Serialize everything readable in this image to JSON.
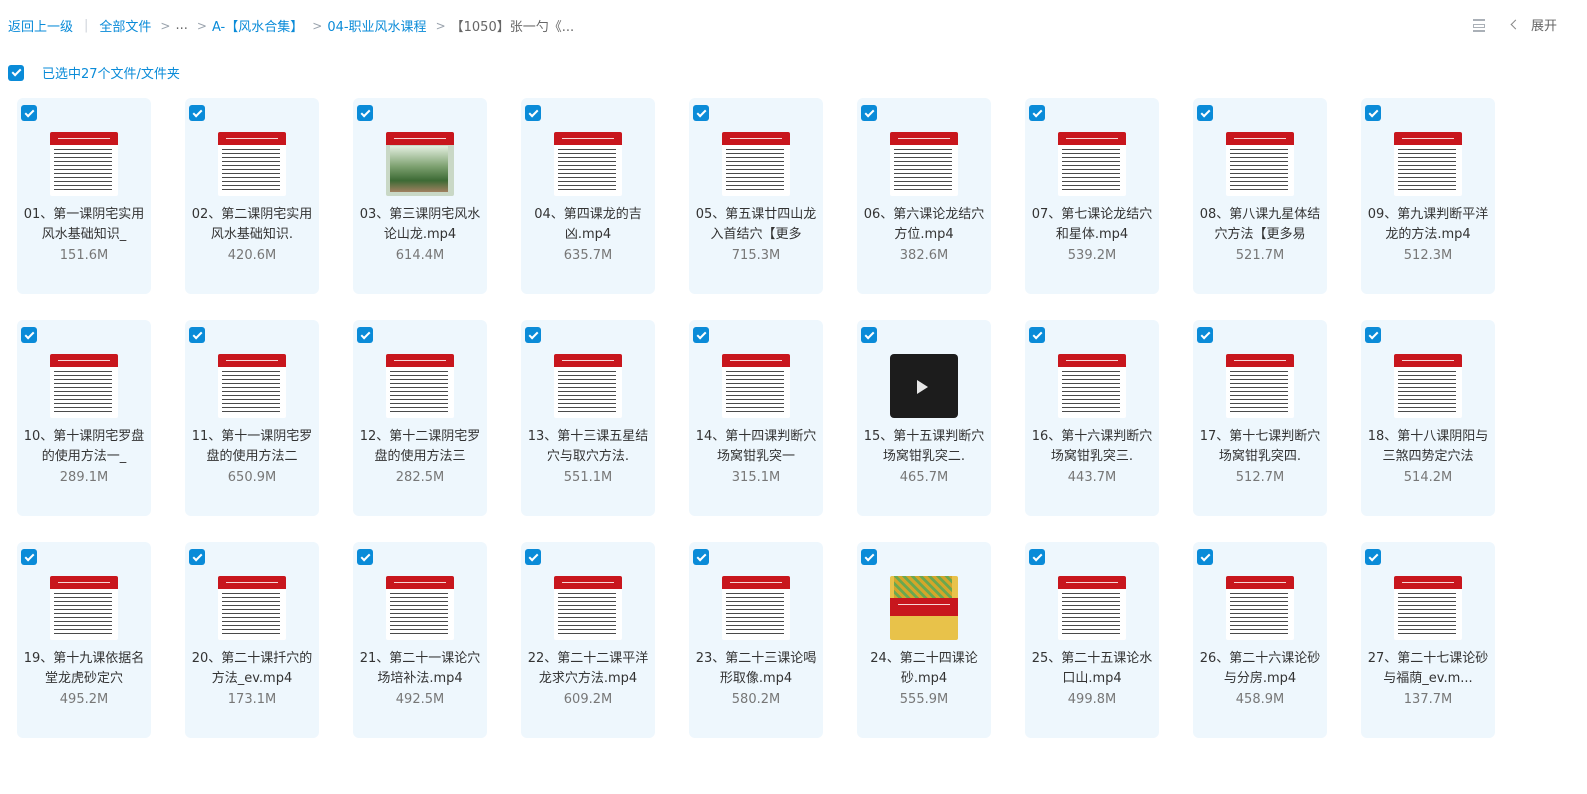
{
  "breadcrumb": {
    "back": "返回上一级",
    "all_files": "全部文件",
    "ellipsis": "...",
    "sep": ">",
    "level1": "A-【风水合集】",
    "level2": "04-职业风水课程",
    "current": "【1050】张一勺《..."
  },
  "toolbar": {
    "expand_label": "展开",
    "list_icon": "list-view-icon"
  },
  "selection": {
    "label": "已选中27个文件/文件夹"
  },
  "colors": {
    "accent": "#0a8bd8",
    "card_bg": "#eef7fd",
    "thumb_red": "#c8161d"
  },
  "files": [
    {
      "name": "01、第一课阴宅实用风水基础知识_",
      "size": "151.6M",
      "thumb": "doc"
    },
    {
      "name": "02、第二课阴宅实用风水基础知识.",
      "size": "420.6M",
      "thumb": "doc"
    },
    {
      "name": "03、第三课阴宅风水论山龙.mp4",
      "size": "614.4M",
      "thumb": "landscape"
    },
    {
      "name": "04、第四课龙的吉凶.mp4",
      "size": "635.7M",
      "thumb": "doc"
    },
    {
      "name": "05、第五课廿四山龙入首结穴【更多",
      "size": "715.3M",
      "thumb": "doc"
    },
    {
      "name": "06、第六课论龙结穴方位.mp4",
      "size": "382.6M",
      "thumb": "doc"
    },
    {
      "name": "07、第七课论龙结穴和星体.mp4",
      "size": "539.2M",
      "thumb": "doc"
    },
    {
      "name": "08、第八课九星体结穴方法【更多易",
      "size": "521.7M",
      "thumb": "doc"
    },
    {
      "name": "09、第九课判断平洋龙的方法.mp4",
      "size": "512.3M",
      "thumb": "doc"
    },
    {
      "name": "10、第十课阴宅罗盘的使用方法一_",
      "size": "289.1M",
      "thumb": "doc"
    },
    {
      "name": "11、第十一课阴宅罗盘的使用方法二",
      "size": "650.9M",
      "thumb": "doc"
    },
    {
      "name": "12、第十二课阴宅罗盘的使用方法三",
      "size": "282.5M",
      "thumb": "doc"
    },
    {
      "name": "13、第十三课五星结穴与取穴方法.",
      "size": "551.1M",
      "thumb": "doc"
    },
    {
      "name": "14、第十四课判断穴场窝钳乳突一",
      "size": "315.1M",
      "thumb": "doc"
    },
    {
      "name": "15、第十五课判断穴场窝钳乳突二.",
      "size": "465.7M",
      "thumb": "dark"
    },
    {
      "name": "16、第十六课判断穴场窝钳乳突三.",
      "size": "443.7M",
      "thumb": "doc"
    },
    {
      "name": "17、第十七课判断穴场窝钳乳突四.",
      "size": "512.7M",
      "thumb": "doc"
    },
    {
      "name": "18、第十八课阴阳与三煞四势定穴法",
      "size": "514.2M",
      "thumb": "doc"
    },
    {
      "name": "19、第十九课依据名堂龙虎砂定穴",
      "size": "495.2M",
      "thumb": "doc"
    },
    {
      "name": "20、第二十课扦穴的方法_ev.mp4",
      "size": "173.1M",
      "thumb": "doc"
    },
    {
      "name": "21、第二十一课论穴场培补法.mp4",
      "size": "492.5M",
      "thumb": "doc"
    },
    {
      "name": "22、第二十二课平洋龙求穴方法.mp4",
      "size": "609.2M",
      "thumb": "doc"
    },
    {
      "name": "23、第二十三课论喝形取像.mp4",
      "size": "580.2M",
      "thumb": "doc"
    },
    {
      "name": "24、第二十四课论砂.mp4",
      "size": "555.9M",
      "thumb": "colorful"
    },
    {
      "name": "25、第二十五课论水口山.mp4",
      "size": "499.8M",
      "thumb": "doc"
    },
    {
      "name": "26、第二十六课论砂与分房.mp4",
      "size": "458.9M",
      "thumb": "doc"
    },
    {
      "name": "27、第二十七课论砂与福荫_ev.m...",
      "size": "137.7M",
      "thumb": "doc"
    }
  ]
}
